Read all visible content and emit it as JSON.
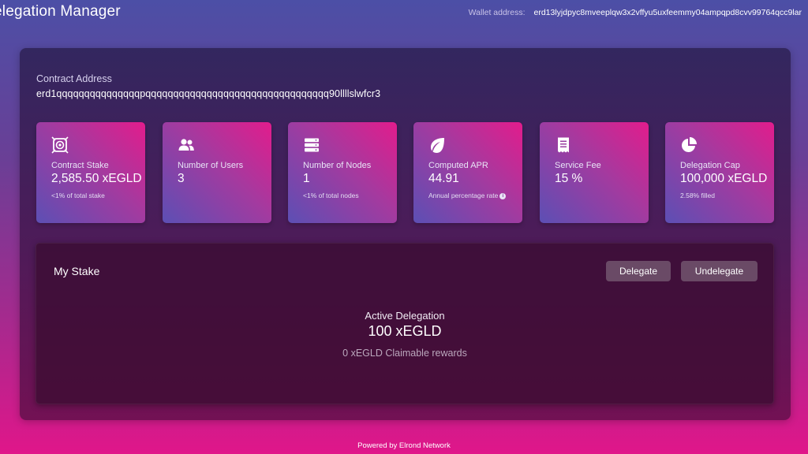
{
  "header": {
    "title": "elegation Manager",
    "wallet_label": "Wallet address:",
    "wallet_address": "erd13lyjdpyc8mveeplqw3x2vffyu5uxfeemmy04ampqpd8cvv99764qcc9lar"
  },
  "contract": {
    "label": "Contract Address",
    "address": "erd1qqqqqqqqqqqqqqqpqqqqqqqqqqqqqqqqqqqqqqqqqqqqqqqqq90llllslwfcr3"
  },
  "cards": [
    {
      "icon": "stake-icon",
      "label": "Contract Stake",
      "value": "2,585.50 xEGLD",
      "sub": "<1% of total stake"
    },
    {
      "icon": "users-icon",
      "label": "Number of Users",
      "value": "3",
      "sub": ""
    },
    {
      "icon": "server-icon",
      "label": "Number of Nodes",
      "value": "1",
      "sub": "<1% of total nodes"
    },
    {
      "icon": "leaf-icon",
      "label": "Computed APR",
      "value": "44.91",
      "sub": "Annual percentage rate"
    },
    {
      "icon": "receipt-icon",
      "label": "Service Fee",
      "value": "15 %",
      "sub": ""
    },
    {
      "icon": "pie-chart-icon",
      "label": "Delegation Cap",
      "value": "100,000 xEGLD",
      "sub": "2.58% filled"
    }
  ],
  "stake": {
    "title": "My Stake",
    "delegate_label": "Delegate",
    "undelegate_label": "Undelegate",
    "active_label": "Active Delegation",
    "active_value": "100 xEGLD",
    "rewards": "0 xEGLD Claimable rewards"
  },
  "footer": {
    "text": "Powered by Elrond Network"
  },
  "colors": {
    "card_gradient_start": "#e21c8c",
    "card_gradient_end": "#5c4fb4",
    "button_bg": "#6a4a66",
    "page_top": "#4c4fa6",
    "page_bottom": "#e0168a"
  }
}
